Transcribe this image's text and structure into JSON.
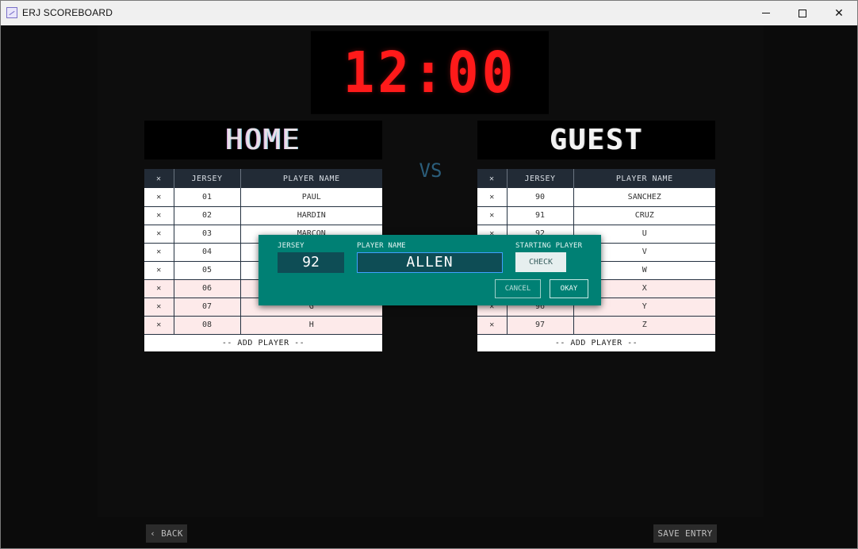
{
  "window": {
    "title": "ERJ SCOREBOARD",
    "close_glyph": "✕"
  },
  "clock": {
    "time": "12:00",
    "color": "#ff1a1a"
  },
  "home": {
    "title": "HOME",
    "headers": [
      "✕",
      "JERSEY",
      "PLAYER NAME"
    ],
    "rows": [
      {
        "remove": "✕",
        "jersey": "01",
        "name": "PAUL"
      },
      {
        "remove": "✕",
        "jersey": "02",
        "name": "HARDIN"
      },
      {
        "remove": "✕",
        "jersey": "03",
        "name": "MARCON"
      },
      {
        "remove": "✕",
        "jersey": "04",
        "name": ""
      },
      {
        "remove": "✕",
        "jersey": "05",
        "name": ""
      },
      {
        "remove": "✕",
        "jersey": "06",
        "name": ""
      },
      {
        "remove": "✕",
        "jersey": "07",
        "name": "G"
      },
      {
        "remove": "✕",
        "jersey": "08",
        "name": "H"
      }
    ],
    "add_label": "-- ADD PLAYER --"
  },
  "vs_label": "VS",
  "guest": {
    "title": "GUEST",
    "headers": [
      "✕",
      "JERSEY",
      "PLAYER NAME"
    ],
    "rows": [
      {
        "remove": "✕",
        "jersey": "90",
        "name": "SANCHEZ"
      },
      {
        "remove": "✕",
        "jersey": "91",
        "name": "CRUZ"
      },
      {
        "remove": "✕",
        "jersey": "92",
        "name": "U"
      },
      {
        "remove": "✕",
        "jersey": "",
        "name": "V"
      },
      {
        "remove": "✕",
        "jersey": "",
        "name": "W"
      },
      {
        "remove": "✕",
        "jersey": "",
        "name": "X"
      },
      {
        "remove": "✕",
        "jersey": "96",
        "name": "Y"
      },
      {
        "remove": "✕",
        "jersey": "97",
        "name": "Z"
      }
    ],
    "add_label": "-- ADD PLAYER --"
  },
  "dialog": {
    "jersey_label": "JERSEY",
    "jersey_value": "92",
    "name_label": "PLAYER NAME",
    "name_value": "ALLEN",
    "starting_label": "STARTING PLAYER",
    "check_label": "CHECK",
    "cancel_label": "CANCEL",
    "okay_label": "OKAY"
  },
  "footer": {
    "back_label": "‹ BACK",
    "save_label": "SAVE ENTRY"
  }
}
